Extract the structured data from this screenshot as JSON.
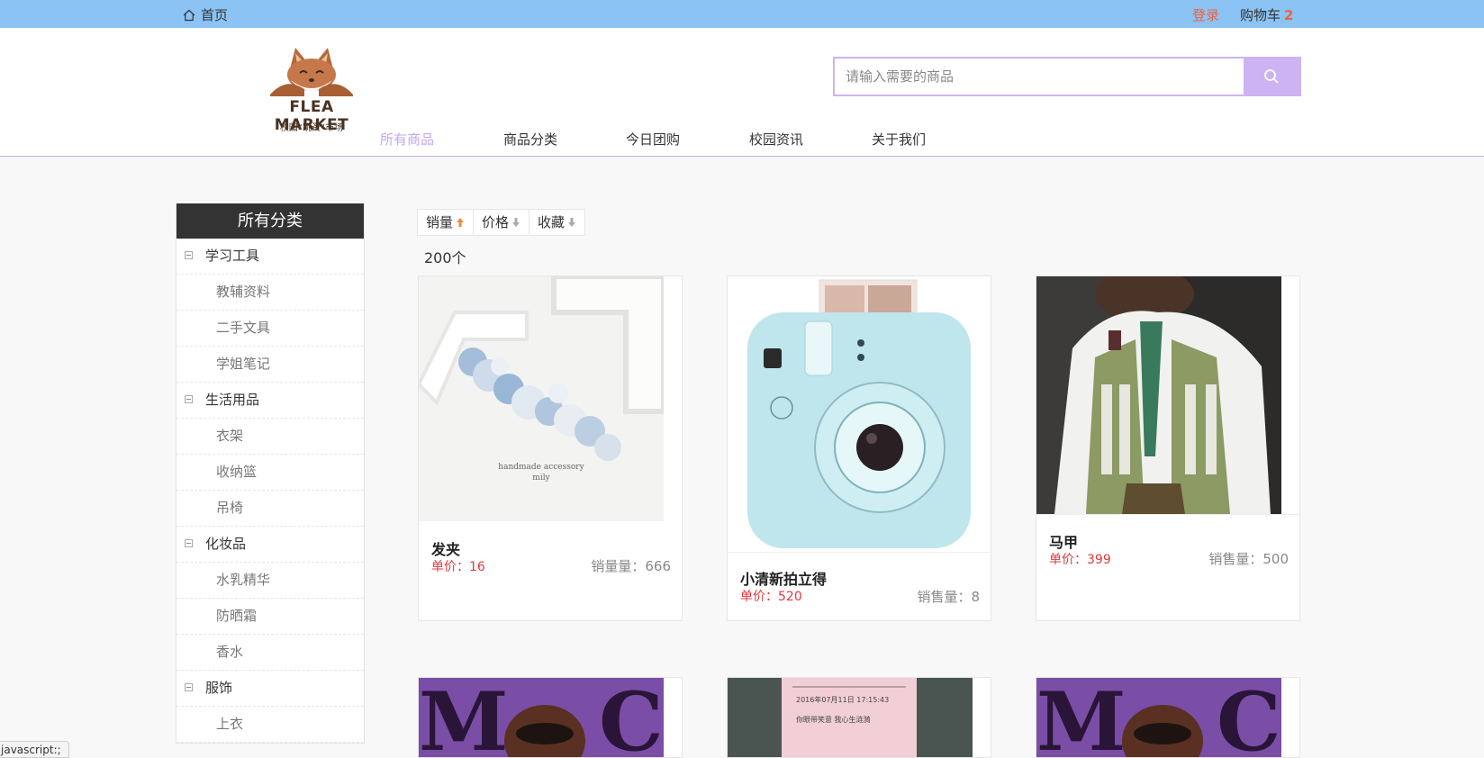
{
  "topbar": {
    "home_label": "首页",
    "login_label": "登录",
    "cart_label": "购物车",
    "cart_count": "2"
  },
  "logo": {
    "text": "FLEA MARKET",
    "subtext": "校园“跳蚤”市场"
  },
  "search": {
    "placeholder": "请输入需要的商品",
    "value": ""
  },
  "nav": [
    {
      "label": "所有商品",
      "active": true
    },
    {
      "label": "商品分类",
      "active": false
    },
    {
      "label": "今日团购",
      "active": false
    },
    {
      "label": "校园资讯",
      "active": false
    },
    {
      "label": "关于我们",
      "active": false
    }
  ],
  "sidebar": {
    "title": "所有分类",
    "items": [
      {
        "label": "学习工具",
        "type": "cat"
      },
      {
        "label": "教辅资料",
        "type": "sub"
      },
      {
        "label": "二手文具",
        "type": "sub"
      },
      {
        "label": "学姐笔记",
        "type": "sub"
      },
      {
        "label": "生活用品",
        "type": "cat"
      },
      {
        "label": "衣架",
        "type": "sub"
      },
      {
        "label": "收纳篮",
        "type": "sub"
      },
      {
        "label": "吊椅",
        "type": "sub"
      },
      {
        "label": "化妆品",
        "type": "cat"
      },
      {
        "label": "水乳精华",
        "type": "sub"
      },
      {
        "label": "防晒霜",
        "type": "sub"
      },
      {
        "label": "香水",
        "type": "sub"
      },
      {
        "label": "服饰",
        "type": "cat"
      },
      {
        "label": "上衣",
        "type": "sub"
      }
    ]
  },
  "sort": [
    {
      "label": "销量",
      "arrow": "up",
      "color": "#f08a3c"
    },
    {
      "label": "价格",
      "arrow": "down",
      "color": "#aaaaaa"
    },
    {
      "label": "收藏",
      "arrow": "down",
      "color": "#aaaaaa"
    }
  ],
  "result_count": "200个",
  "products": [
    {
      "name": "发夹",
      "price": "单价：16",
      "sales": "销量量：666",
      "image_text": "handmade accessory\nmily"
    },
    {
      "name": "小清新拍立得",
      "price": "单价：520",
      "sales": "销售量：8",
      "image_text": ""
    },
    {
      "name": "马甲",
      "price": "单价：399",
      "sales": "销售量：500",
      "image_text": ""
    }
  ],
  "bottom_images": [
    {
      "image_text": ""
    },
    {
      "image_text": "2016年07月11日 17:15:43\n你眼带笑意 我心生涟漪"
    },
    {
      "image_text": ""
    }
  ],
  "status_text": "javascript:;",
  "colors": {
    "topbar": "#8bc3f4",
    "accent": "#cdb3f4",
    "nav_active": "#c6a6f0",
    "price": "#e4393c",
    "login": "#f0623c"
  }
}
